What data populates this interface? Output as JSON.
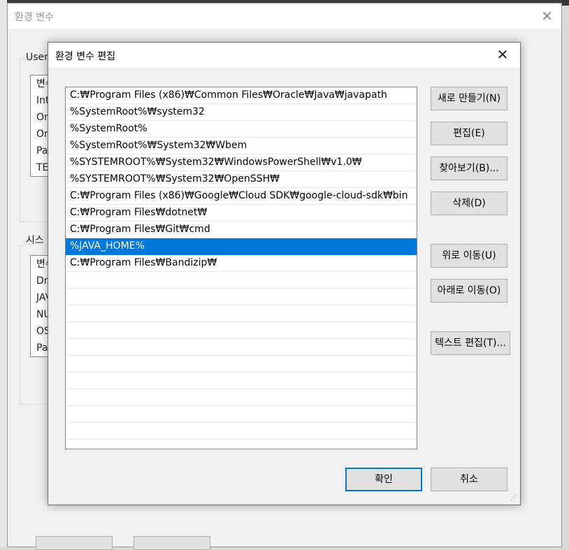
{
  "parent": {
    "title": "환경 변수",
    "user_group_label": "User",
    "system_group_label": "시스",
    "user_list": [
      "변수",
      "Int",
      "On",
      "On",
      "Pa",
      "TE"
    ],
    "system_list": [
      "변수",
      "Dri",
      "JAV",
      "NU",
      "OS",
      "Pa"
    ]
  },
  "dialog": {
    "title": "환경 변수 편집",
    "paths": [
      "C:₩Program Files (x86)₩Common Files₩Oracle₩Java₩javapath",
      "%SystemRoot%₩system32",
      "%SystemRoot%",
      "%SystemRoot%₩System32₩Wbem",
      "%SYSTEMROOT%₩System32₩WindowsPowerShell₩v1.0₩",
      "%SYSTEMROOT%₩System32₩OpenSSH₩",
      "C:₩Program Files (x86)₩Google₩Cloud SDK₩google-cloud-sdk₩bin",
      "C:₩Program Files₩dotnet₩",
      "C:₩Program Files₩Git₩cmd",
      "%JAVA_HOME%",
      "C:₩Program Files₩Bandizip₩"
    ],
    "selected_index": 9,
    "buttons": {
      "new": "새로 만들기(N)",
      "edit": "편집(E)",
      "browse": "찾아보기(B)...",
      "delete": "삭제(D)",
      "move_up": "위로 이동(U)",
      "move_down": "아래로 이동(O)",
      "edit_text": "텍스트 편집(T)...",
      "ok": "확인",
      "cancel": "취소"
    }
  },
  "colors": {
    "selection": "#0078d7",
    "window_bg": "#f0f0f0"
  }
}
